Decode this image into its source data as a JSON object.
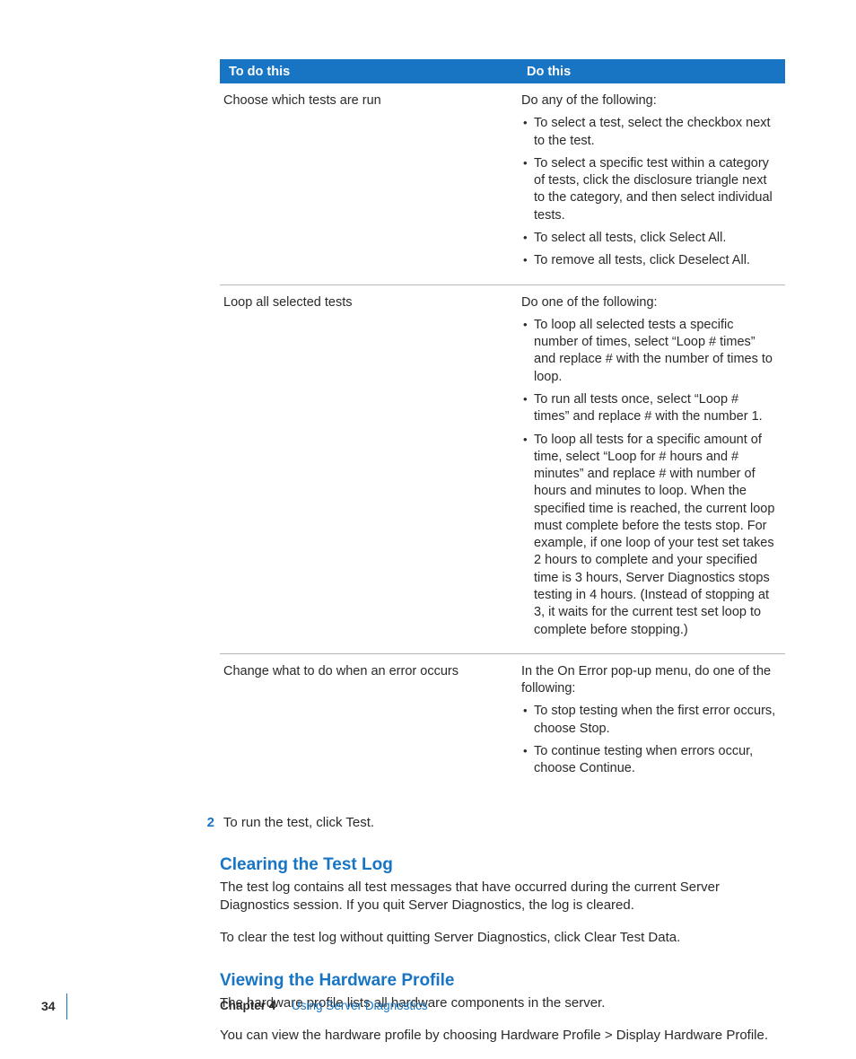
{
  "table": {
    "header": {
      "col1": "To do this",
      "col2": "Do this"
    },
    "rows": [
      {
        "task": "Choose which tests are run",
        "intro": "Do any of the following:",
        "bullets": [
          "To select a test, select the checkbox next to the test.",
          "To select a specific test within a category of tests, click the disclosure triangle next to the category, and then select individual tests.",
          "To select all tests, click Select All.",
          "To remove all tests, click Deselect All."
        ]
      },
      {
        "task": "Loop all selected tests",
        "intro": "Do one of the following:",
        "bullets": [
          "To loop all selected tests a specific number of times, select “Loop # times” and replace # with the number of times to loop.",
          "To run all tests once, select “Loop # times” and replace # with the number 1.",
          "To loop all tests for a specific amount of time, select “Loop for # hours and # minutes” and replace # with number of hours and minutes to loop. When the specified time is reached, the current loop must complete before the tests stop. For example, if one loop of your test set takes 2 hours to complete and your specified time is 3 hours, Server Diagnostics stops testing in 4 hours. (Instead of stopping at 3, it waits for the current test set loop to complete before stopping.)"
        ]
      },
      {
        "task": "Change what to do when an error occurs",
        "intro": "In the On Error pop-up menu, do one of the following:",
        "bullets": [
          "To stop testing when the first error occurs, choose Stop.",
          "To continue testing when errors occur, choose Continue."
        ]
      }
    ]
  },
  "step": {
    "num": "2",
    "text": "To run the test, click Test."
  },
  "sections": [
    {
      "heading": "Clearing the Test Log",
      "paras": [
        "The test log contains all test messages that have occurred during the current Server Diagnostics session. If you quit Server Diagnostics, the log is cleared.",
        "To clear the test log without quitting Server Diagnostics, click Clear Test Data."
      ]
    },
    {
      "heading": "Viewing the Hardware Profile",
      "paras": [
        "The hardware profile lists all hardware components in the server.",
        "You can view the hardware profile by choosing Hardware Profile > Display Hardware Profile."
      ]
    }
  ],
  "footer": {
    "page": "34",
    "chapter": "Chapter 4",
    "title": "Using Server Diagnostics"
  }
}
